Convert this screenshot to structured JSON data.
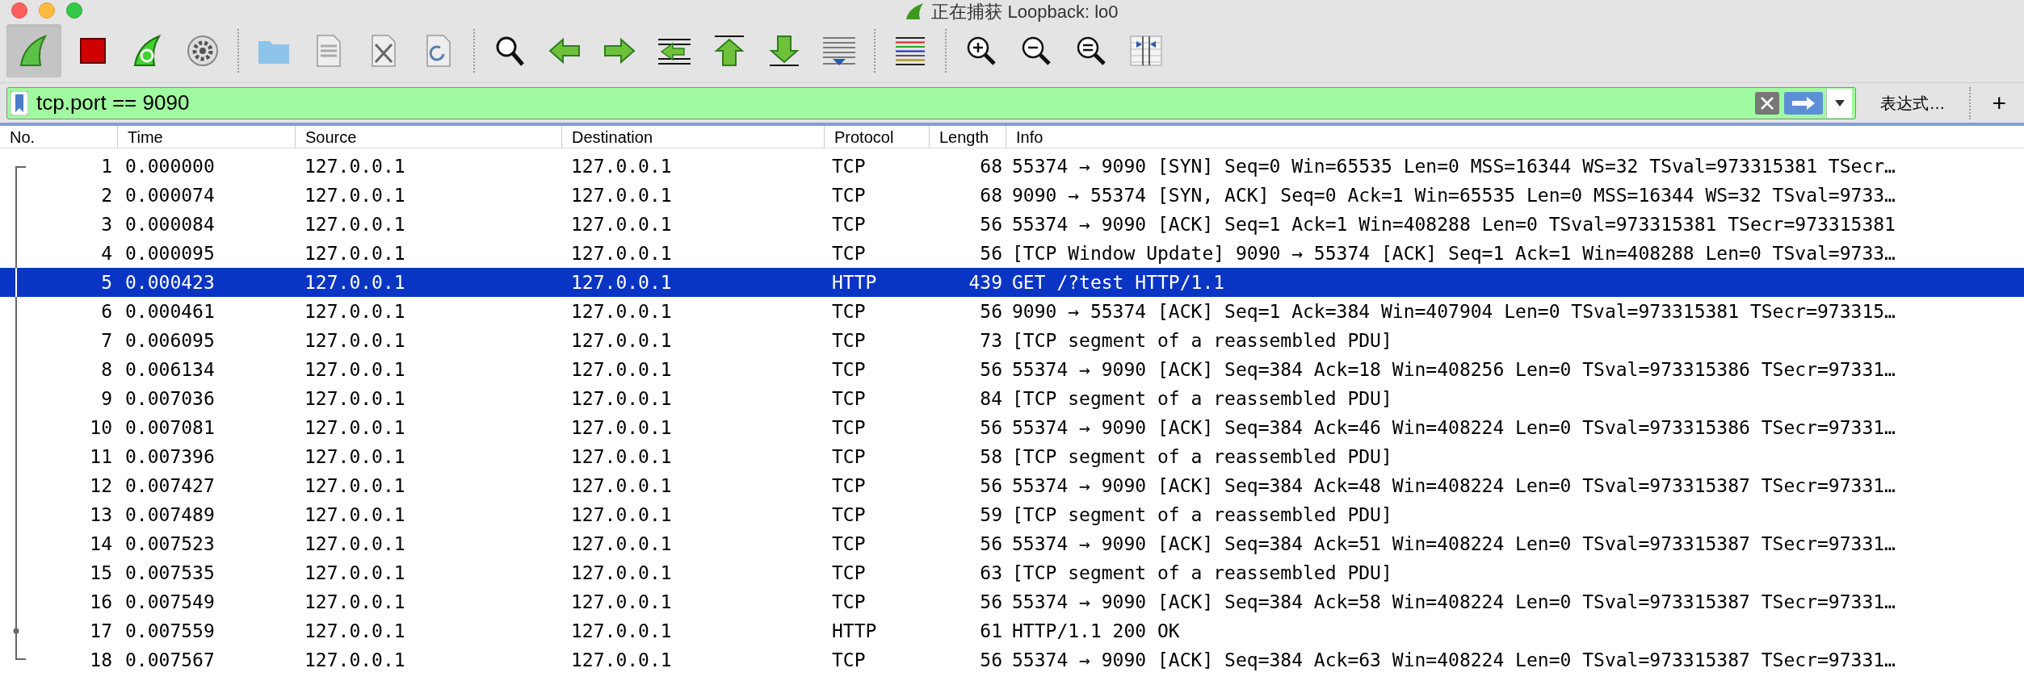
{
  "window": {
    "title": "正在捕获 Loopback: lo0"
  },
  "toolbar": [
    [
      {
        "kind": "start",
        "pressed": true
      },
      {
        "kind": "stop",
        "pressed": false
      },
      {
        "kind": "restart",
        "pressed": false
      },
      {
        "kind": "options",
        "pressed": false
      }
    ],
    [
      {
        "kind": "open",
        "pressed": false
      },
      {
        "kind": "save",
        "pressed": false
      },
      {
        "kind": "close",
        "pressed": false
      },
      {
        "kind": "reload",
        "pressed": false
      }
    ],
    [
      {
        "kind": "find",
        "pressed": false
      },
      {
        "kind": "back",
        "pressed": false
      },
      {
        "kind": "forward",
        "pressed": false
      },
      {
        "kind": "goto",
        "pressed": false
      },
      {
        "kind": "first",
        "pressed": false
      },
      {
        "kind": "last",
        "pressed": false
      },
      {
        "kind": "autoscroll",
        "pressed": false
      }
    ],
    [
      {
        "kind": "colorize",
        "pressed": false
      }
    ],
    [
      {
        "kind": "zoom_in",
        "pressed": false
      },
      {
        "kind": "zoom_out",
        "pressed": false
      },
      {
        "kind": "zoom_reset",
        "pressed": false
      },
      {
        "kind": "resize",
        "pressed": false
      }
    ]
  ],
  "filter": {
    "value": "tcp.port == 9090",
    "expression_button": "表达式…",
    "add_button": "+"
  },
  "table": {
    "columns": [
      "No.",
      "Time",
      "Source",
      "Destination",
      "Protocol",
      "Length",
      "Info"
    ],
    "rows": [
      {
        "no": "1",
        "time": "0.000000",
        "source": "127.0.0.1",
        "destination": "127.0.0.1",
        "protocol": "TCP",
        "length": "68",
        "info": "55374 → 9090 [SYN] Seq=0 Win=65535 Len=0 MSS=16344 WS=32 TSval=973315381 TSecr…",
        "selected": false,
        "kind": "first"
      },
      {
        "no": "2",
        "time": "0.000074",
        "source": "127.0.0.1",
        "destination": "127.0.0.1",
        "protocol": "TCP",
        "length": "68",
        "info": "9090 → 55374 [SYN, ACK] Seq=0 Ack=1 Win=65535 Len=0 MSS=16344 WS=32 TSval=9733…",
        "selected": false,
        "kind": "middle"
      },
      {
        "no": "3",
        "time": "0.000084",
        "source": "127.0.0.1",
        "destination": "127.0.0.1",
        "protocol": "TCP",
        "length": "56",
        "info": "55374 → 9090 [ACK] Seq=1 Ack=1 Win=408288 Len=0 TSval=973315381 TSecr=973315381",
        "selected": false,
        "kind": "middle"
      },
      {
        "no": "4",
        "time": "0.000095",
        "source": "127.0.0.1",
        "destination": "127.0.0.1",
        "protocol": "TCP",
        "length": "56",
        "info": "[TCP Window Update] 9090 → 55374 [ACK] Seq=1 Ack=1 Win=408288 Len=0 TSval=9733…",
        "selected": false,
        "kind": "middle"
      },
      {
        "no": "5",
        "time": "0.000423",
        "source": "127.0.0.1",
        "destination": "127.0.0.1",
        "protocol": "HTTP",
        "length": "439",
        "info": "GET /?test HTTP/1.1",
        "selected": true,
        "kind": "middle"
      },
      {
        "no": "6",
        "time": "0.000461",
        "source": "127.0.0.1",
        "destination": "127.0.0.1",
        "protocol": "TCP",
        "length": "56",
        "info": "9090 → 55374 [ACK] Seq=1 Ack=384 Win=407904 Len=0 TSval=973315381 TSecr=973315…",
        "selected": false,
        "kind": "middle"
      },
      {
        "no": "7",
        "time": "0.006095",
        "source": "127.0.0.1",
        "destination": "127.0.0.1",
        "protocol": "TCP",
        "length": "73",
        "info": "[TCP segment of a reassembled PDU]",
        "selected": false,
        "kind": "middle"
      },
      {
        "no": "8",
        "time": "0.006134",
        "source": "127.0.0.1",
        "destination": "127.0.0.1",
        "protocol": "TCP",
        "length": "56",
        "info": "55374 → 9090 [ACK] Seq=384 Ack=18 Win=408256 Len=0 TSval=973315386 TSecr=97331…",
        "selected": false,
        "kind": "middle"
      },
      {
        "no": "9",
        "time": "0.007036",
        "source": "127.0.0.1",
        "destination": "127.0.0.1",
        "protocol": "TCP",
        "length": "84",
        "info": "[TCP segment of a reassembled PDU]",
        "selected": false,
        "kind": "middle"
      },
      {
        "no": "10",
        "time": "0.007081",
        "source": "127.0.0.1",
        "destination": "127.0.0.1",
        "protocol": "TCP",
        "length": "56",
        "info": "55374 → 9090 [ACK] Seq=384 Ack=46 Win=408224 Len=0 TSval=973315386 TSecr=97331…",
        "selected": false,
        "kind": "middle"
      },
      {
        "no": "11",
        "time": "0.007396",
        "source": "127.0.0.1",
        "destination": "127.0.0.1",
        "protocol": "TCP",
        "length": "58",
        "info": "[TCP segment of a reassembled PDU]",
        "selected": false,
        "kind": "middle"
      },
      {
        "no": "12",
        "time": "0.007427",
        "source": "127.0.0.1",
        "destination": "127.0.0.1",
        "protocol": "TCP",
        "length": "56",
        "info": "55374 → 9090 [ACK] Seq=384 Ack=48 Win=408224 Len=0 TSval=973315387 TSecr=97331…",
        "selected": false,
        "kind": "middle"
      },
      {
        "no": "13",
        "time": "0.007489",
        "source": "127.0.0.1",
        "destination": "127.0.0.1",
        "protocol": "TCP",
        "length": "59",
        "info": "[TCP segment of a reassembled PDU]",
        "selected": false,
        "kind": "middle"
      },
      {
        "no": "14",
        "time": "0.007523",
        "source": "127.0.0.1",
        "destination": "127.0.0.1",
        "protocol": "TCP",
        "length": "56",
        "info": "55374 → 9090 [ACK] Seq=384 Ack=51 Win=408224 Len=0 TSval=973315387 TSecr=97331…",
        "selected": false,
        "kind": "middle"
      },
      {
        "no": "15",
        "time": "0.007535",
        "source": "127.0.0.1",
        "destination": "127.0.0.1",
        "protocol": "TCP",
        "length": "63",
        "info": "[TCP segment of a reassembled PDU]",
        "selected": false,
        "kind": "middle"
      },
      {
        "no": "16",
        "time": "0.007549",
        "source": "127.0.0.1",
        "destination": "127.0.0.1",
        "protocol": "TCP",
        "length": "56",
        "info": "55374 → 9090 [ACK] Seq=384 Ack=58 Win=408224 Len=0 TSval=973315387 TSecr=97331…",
        "selected": false,
        "kind": "middle"
      },
      {
        "no": "17",
        "time": "0.007559",
        "source": "127.0.0.1",
        "destination": "127.0.0.1",
        "protocol": "HTTP",
        "length": "61",
        "info": "HTTP/1.1 200 OK",
        "selected": false,
        "kind": "response"
      },
      {
        "no": "18",
        "time": "0.007567",
        "source": "127.0.0.1",
        "destination": "127.0.0.1",
        "protocol": "TCP",
        "length": "56",
        "info": "55374 → 9090 [ACK] Seq=384 Ack=63 Win=408224 Len=0 TSval=973315387 TSecr=97331…",
        "selected": false,
        "kind": "last"
      }
    ]
  }
}
